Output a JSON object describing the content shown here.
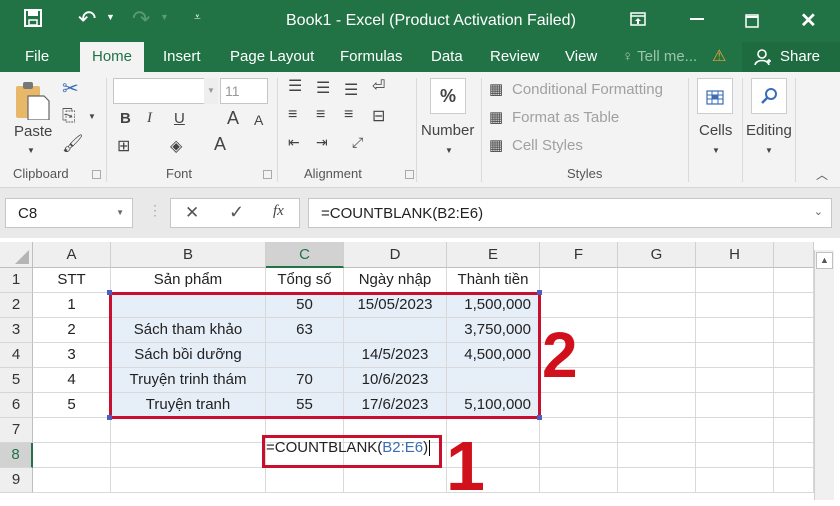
{
  "titlebar": {
    "title": "Book1 - Excel (Product Activation Failed)",
    "icons": {
      "save": "save-icon",
      "undo": "undo-icon",
      "redo": "redo-icon",
      "customize": "customize-qat-icon"
    },
    "window_buttons": {
      "ribbon_display": "ribbon-display-icon",
      "minimize": "minimize-icon",
      "maximize": "maximize-icon",
      "close": "close-icon"
    }
  },
  "tabs": {
    "items": [
      "File",
      "Home",
      "Insert",
      "Page Layout",
      "Formulas",
      "Data",
      "Review",
      "View"
    ],
    "active": "Home",
    "tell_me": "Tell me...",
    "share": "Share"
  },
  "ribbon": {
    "clipboard": {
      "label": "Clipboard",
      "paste": "Paste"
    },
    "font": {
      "label": "Font",
      "font_name": "",
      "font_size": "11",
      "bold": "B",
      "italic": "I",
      "underline": "U",
      "grow": "A",
      "shrink": "A",
      "font_color": "A"
    },
    "alignment": {
      "label": "Alignment"
    },
    "number": {
      "label": "Number",
      "percent": "%"
    },
    "styles": {
      "label": "Styles",
      "conditional": "Conditional Formatting",
      "format_table": "Format as Table",
      "cell_styles": "Cell Styles"
    },
    "cells": {
      "label": "Cells"
    },
    "editing": {
      "label": "Editing"
    }
  },
  "formula_bar": {
    "name_box": "C8",
    "cancel": "✕",
    "enter": "✓",
    "fx": "fx",
    "formula": "=COUNTBLANK(B2:E6)"
  },
  "sheet": {
    "columns": [
      "A",
      "B",
      "C",
      "D",
      "E",
      "F",
      "G",
      "H"
    ],
    "selected_column": "C",
    "rows": [
      "1",
      "2",
      "3",
      "4",
      "5",
      "6",
      "7",
      "8",
      "9"
    ],
    "selected_row": "8",
    "headers": [
      "STT",
      "Sản phẩm",
      "Tổng số",
      "Ngày nhập",
      "Thành tiền"
    ],
    "data": [
      [
        "1",
        "",
        "50",
        "15/05/2023",
        "1,500,000"
      ],
      [
        "2",
        "Sách tham khảo",
        "63",
        "",
        "3,750,000"
      ],
      [
        "3",
        "Sách bồi dưỡng",
        "",
        "14/5/2023",
        "4,500,000"
      ],
      [
        "4",
        "Truyện trinh thám",
        "70",
        "10/6/2023",
        ""
      ],
      [
        "5",
        "Truyện tranh",
        "55",
        "17/6/2023",
        "5,100,000"
      ]
    ],
    "editing_cell": {
      "ref": "C8",
      "prefix": "=COUNTBLANK(",
      "range": "B2:E6",
      "suffix": ")"
    }
  },
  "annotations": {
    "step1": "1",
    "step2": "2",
    "color": "#c8102e"
  }
}
